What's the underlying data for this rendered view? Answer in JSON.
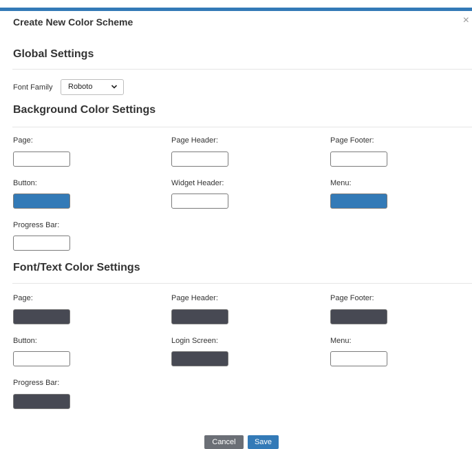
{
  "dialog": {
    "title": "Create New Color Scheme",
    "close": "×"
  },
  "global": {
    "title": "Global Settings",
    "font_family_label": "Font Family",
    "font_family_value": "Roboto"
  },
  "background": {
    "title": "Background Color Settings",
    "fields": {
      "page": {
        "label": "Page:",
        "color": "#ffffff"
      },
      "page_header": {
        "label": "Page Header:",
        "color": "#ffffff"
      },
      "page_footer": {
        "label": "Page Footer:",
        "color": "#ffffff"
      },
      "button": {
        "label": "Button:",
        "color": "#337ab7"
      },
      "widget_header": {
        "label": "Widget Header:",
        "color": "#ffffff"
      },
      "menu": {
        "label": "Menu:",
        "color": "#337ab7"
      },
      "progress_bar": {
        "label": "Progress Bar:",
        "color": "#ffffff"
      }
    }
  },
  "text": {
    "title": "Font/Text Color Settings",
    "fields": {
      "page": {
        "label": "Page:",
        "color": "#474953"
      },
      "page_header": {
        "label": "Page Header:",
        "color": "#474953"
      },
      "page_footer": {
        "label": "Page Footer:",
        "color": "#474953"
      },
      "button": {
        "label": "Button:",
        "color": "#ffffff"
      },
      "login_screen": {
        "label": "Login Screen:",
        "color": "#474953"
      },
      "menu": {
        "label": "Menu:",
        "color": "#ffffff"
      },
      "progress_bar": {
        "label": "Progress Bar:",
        "color": "#474953"
      }
    }
  },
  "footer": {
    "cancel_label": "Cancel",
    "save_label": "Save"
  }
}
